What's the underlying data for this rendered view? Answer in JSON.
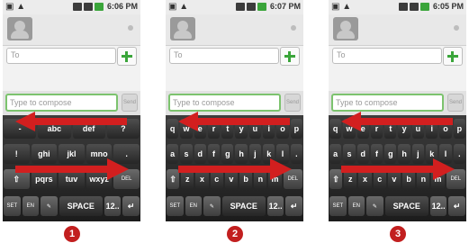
{
  "arrow_color": "#d21f1f",
  "panels": [
    {
      "status_time": "6:06 PM",
      "to_placeholder": "To",
      "compose_placeholder": "Type to compose",
      "send_label": "Send",
      "badge": "1",
      "rows": [
        [
          "-",
          "abc",
          "def",
          "?"
        ],
        [
          "!",
          "ghi",
          "jkl",
          "mno",
          "."
        ],
        [
          "⇧",
          "pqrs",
          "tuv",
          "wxyz",
          "DEL"
        ],
        [
          "SET",
          "EN",
          "✎",
          "SPACE",
          "12..",
          "↵"
        ]
      ]
    },
    {
      "status_time": "6:07 PM",
      "to_placeholder": "To",
      "compose_placeholder": "Type to compose",
      "send_label": "Send",
      "badge": "2",
      "rows": [
        [
          "q",
          "w",
          "e",
          "r",
          "t",
          "y",
          "u",
          "i",
          "o",
          "p"
        ],
        [
          "a",
          "s",
          "d",
          "f",
          "g",
          "h",
          "j",
          "k",
          "l",
          "."
        ],
        [
          "⇧",
          "z",
          "x",
          "c",
          "v",
          "b",
          "n",
          "m",
          "DEL"
        ],
        [
          "SET",
          "EN",
          "✎",
          "SPACE",
          "12..",
          "↵"
        ]
      ]
    },
    {
      "status_time": "6:05 PM",
      "to_placeholder": "To",
      "compose_placeholder": "Type to compose",
      "send_label": "Send",
      "badge": "3",
      "rows": [
        [
          "q",
          "w",
          "e",
          "r",
          "t",
          "y",
          "u",
          "i",
          "o",
          "p"
        ],
        [
          "a",
          "s",
          "d",
          "f",
          "g",
          "h",
          "j",
          "k",
          "l",
          "."
        ],
        [
          "⇧",
          "z",
          "x",
          "c",
          "v",
          "b",
          "n",
          "m",
          "DEL"
        ],
        [
          "SET",
          "EN",
          "✎",
          "SPACE",
          "12..",
          "↵"
        ]
      ]
    }
  ]
}
